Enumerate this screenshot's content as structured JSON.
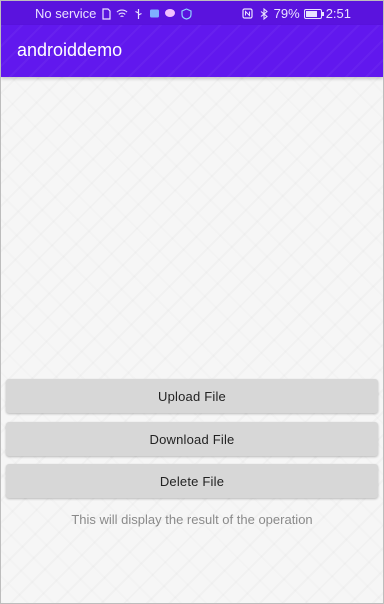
{
  "status_bar": {
    "carrier": "No service",
    "battery": "79%",
    "battery_level": 0.79,
    "time": "2:51",
    "icons": [
      "sim-icon",
      "wifi-icon",
      "usb-icon",
      "notification-icon",
      "chat-icon",
      "shield-icon",
      "nfc-icon",
      "bluetooth-icon",
      "battery-icon"
    ]
  },
  "app_bar": {
    "title": "androiddemo",
    "color": "#6118ee"
  },
  "buttons": {
    "upload": "Upload File",
    "download": "Download File",
    "delete": "Delete File"
  },
  "result_text": "This will display the result of the operation"
}
